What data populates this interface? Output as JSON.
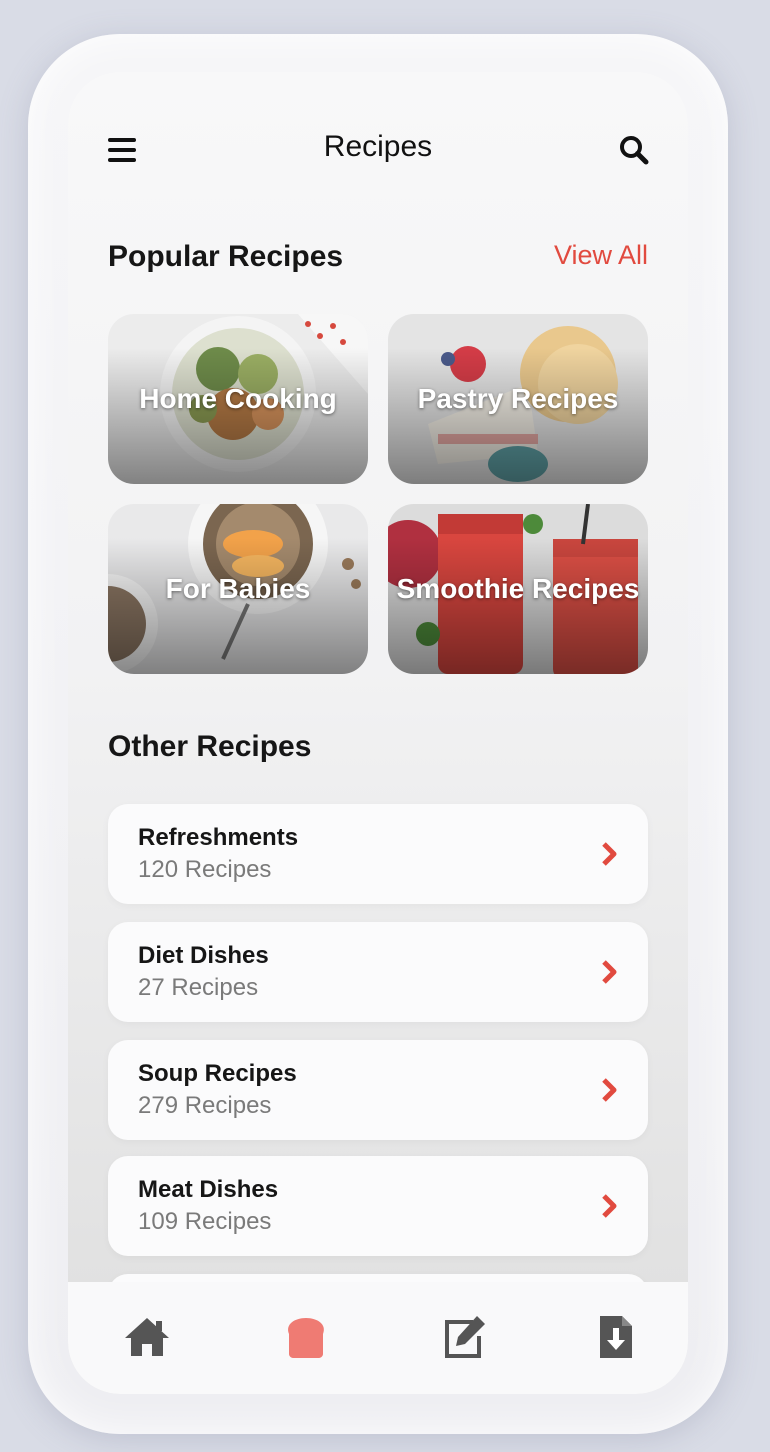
{
  "header": {
    "title": "Recipes",
    "menu_icon": "menu-icon",
    "search_icon": "search-icon"
  },
  "popular": {
    "title": "Popular Recipes",
    "view_all": "View All",
    "cards": [
      {
        "label": "Home Cooking"
      },
      {
        "label": "Pastry Recipes"
      },
      {
        "label": "For Babies"
      },
      {
        "label": "Smoothie Recipes"
      }
    ]
  },
  "other": {
    "title": "Other Recipes",
    "items": [
      {
        "name": "Refreshments",
        "count": "120 Recipes"
      },
      {
        "name": "Diet Dishes",
        "count": "27 Recipes"
      },
      {
        "name": "Soup Recipes",
        "count": "279 Recipes"
      },
      {
        "name": "Meat Dishes",
        "count": "109 Recipes"
      }
    ]
  },
  "nav": {
    "items": [
      {
        "icon": "home-icon",
        "active": false
      },
      {
        "icon": "bread-icon",
        "active": true
      },
      {
        "icon": "edit-icon",
        "active": false
      },
      {
        "icon": "file-download-icon",
        "active": false
      }
    ]
  },
  "colors": {
    "accent": "#e14a3f",
    "active_nav": "#ef7b73",
    "inactive_nav": "#555555"
  }
}
